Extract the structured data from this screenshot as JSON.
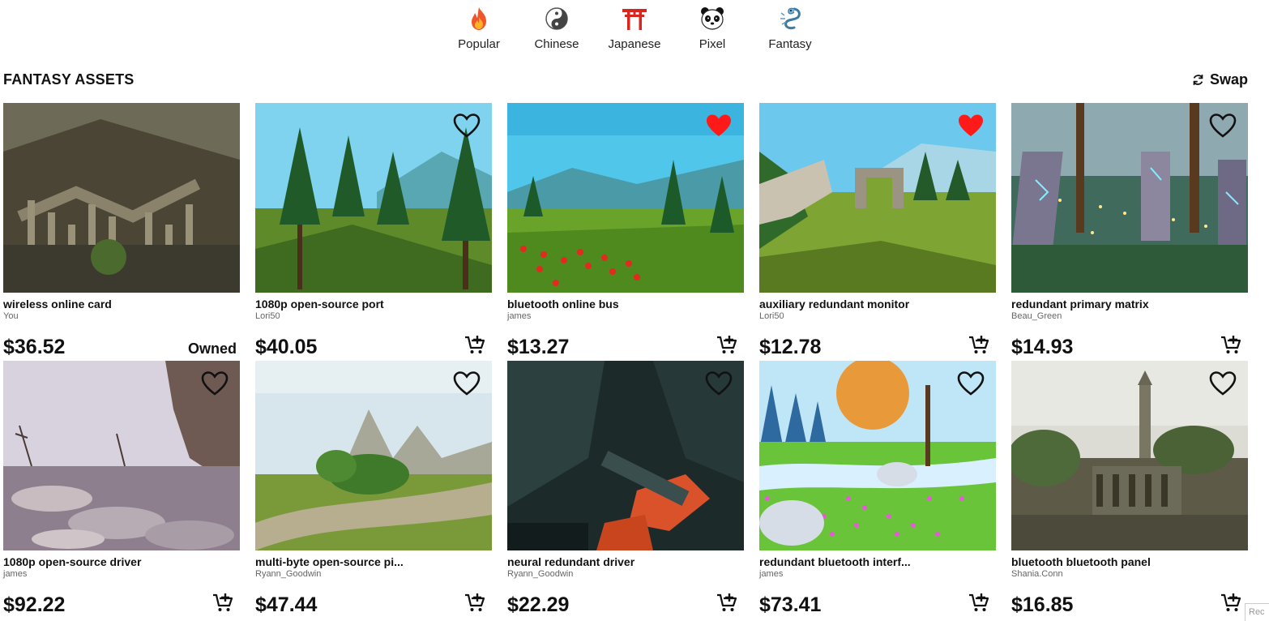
{
  "categories": [
    {
      "label": "Popular",
      "icon": "fire-icon"
    },
    {
      "label": "Chinese",
      "icon": "yin-yang-icon"
    },
    {
      "label": "Japanese",
      "icon": "torii-gate-icon"
    },
    {
      "label": "Pixel",
      "icon": "panda-icon"
    },
    {
      "label": "Fantasy",
      "icon": "dragon-icon"
    }
  ],
  "section": {
    "title": "FANTASY ASSETS",
    "swap_label": "Swap"
  },
  "assets": [
    {
      "name": "wireless online card",
      "author": "You",
      "price": "$36.52",
      "status": "Owned",
      "favorited": false,
      "scene": "ruins"
    },
    {
      "name": "1080p open-source port",
      "author": "Lori50",
      "price": "$40.05",
      "favorited": false,
      "scene": "forest"
    },
    {
      "name": "bluetooth online bus",
      "author": "james",
      "price": "$13.27",
      "favorited": true,
      "scene": "meadow"
    },
    {
      "name": "auxiliary redundant monitor",
      "author": "Lori50",
      "price": "$12.78",
      "favorited": true,
      "scene": "arch"
    },
    {
      "name": "redundant primary matrix",
      "author": "Beau_Green",
      "price": "$14.93",
      "favorited": false,
      "scene": "runes"
    },
    {
      "name": "1080p open-source driver",
      "author": "james",
      "price": "$92.22",
      "favorited": false,
      "scene": "rocks"
    },
    {
      "name": "multi-byte open-source pi...",
      "author": "Ryann_Goodwin",
      "price": "$47.44",
      "favorited": false,
      "scene": "valley"
    },
    {
      "name": "neural redundant driver",
      "author": "Ryann_Goodwin",
      "price": "$22.29",
      "favorited": false,
      "scene": "lava"
    },
    {
      "name": "redundant bluetooth interf...",
      "author": "james",
      "price": "$73.41",
      "favorited": false,
      "scene": "flowers"
    },
    {
      "name": "bluetooth bluetooth panel",
      "author": "Shania.Conn",
      "price": "$16.85",
      "favorited": false,
      "scene": "tower"
    }
  ],
  "colors": {
    "heart_filled": "#ff1a1a",
    "text": "#111111",
    "muted": "#666666"
  },
  "corner_tag": "Rec"
}
